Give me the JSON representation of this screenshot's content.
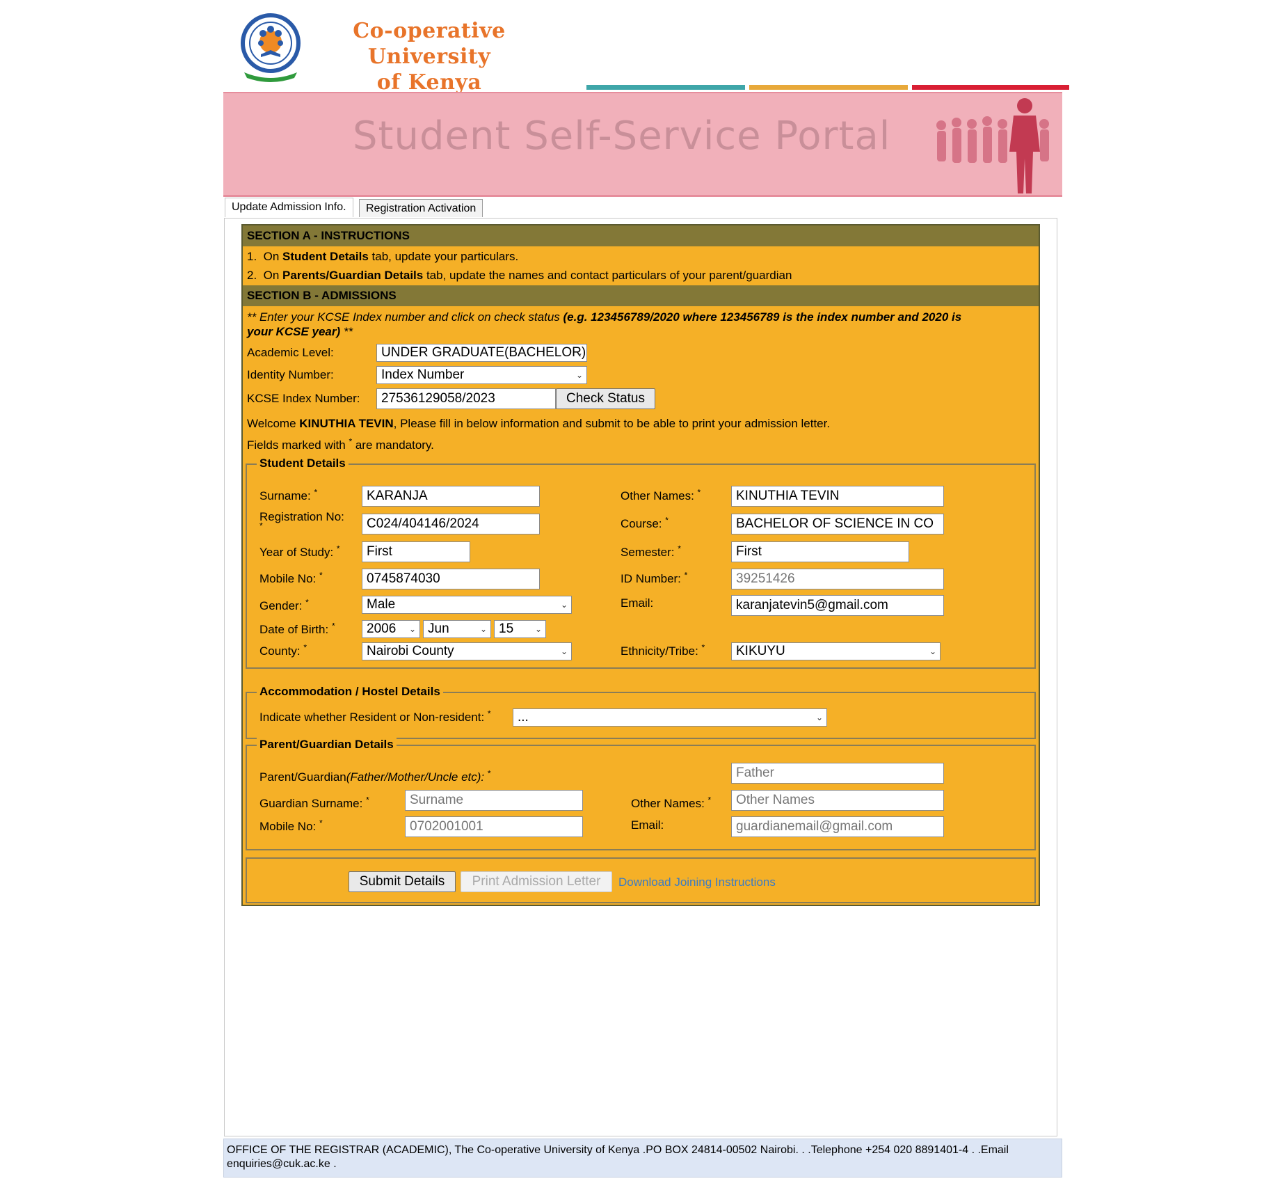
{
  "header": {
    "logo_line1": "Co-operative University",
    "logo_line2": "of Kenya",
    "banner_title": "Student Self-Service Portal",
    "stripe_colors": [
      "#3fa6a9",
      "#e8a93a",
      "#d91f34"
    ]
  },
  "tabs": [
    {
      "label": "Update Admission Info.",
      "active": true
    },
    {
      "label": "Registration Activation",
      "active": false
    }
  ],
  "section_a": {
    "title": "SECTION A - INSTRUCTIONS",
    "line1_num": "1.",
    "line1_pre": "On ",
    "line1_bold": "Student Details",
    "line1_post": " tab, update your particulars.",
    "line2_num": "2.",
    "line2_pre": "On ",
    "line2_bold": "Parents/Guardian Details",
    "line2_post": " tab, update the names and contact particulars of your parent/guardian"
  },
  "section_b": {
    "title": "SECTION B - ADMISSIONS",
    "note_a": "** Enter your KCSE Index number and click on check status ",
    "note_b": "(e.g. 123456789/2020 where 123456789 is the index number and 2020 is",
    "note_c": "your KCSE year)",
    "note_d": " **",
    "academic_level_label": "Academic Level:",
    "academic_level_value": "UNDER GRADUATE(BACHELOR)",
    "identity_label": "Identity Number:",
    "identity_value": "Index Number",
    "kcse_label": "KCSE Index Number:",
    "kcse_value": "27536129058/2023",
    "check_status_label": "Check Status",
    "welcome_pre": "Welcome ",
    "welcome_name": "KINUTHIA TEVIN",
    "welcome_post": ", Please fill in below information and submit to be able to print your admission letter.",
    "mandatory_pre": "Fields marked with ",
    "mandatory_post": " are mandatory."
  },
  "student_details": {
    "legend": "Student Details",
    "surname_label": "Surname:",
    "surname_value": "KARANJA",
    "other_names_label": "Other Names:",
    "other_names_value": "KINUTHIA TEVIN",
    "reg_label": "Registration No:",
    "reg_value": "C024/404146/2024",
    "course_label": "Course:",
    "course_value": "BACHELOR OF SCIENCE IN CO",
    "year_label": "Year of Study:",
    "year_value": "First",
    "semester_label": "Semester:",
    "semester_value": "First",
    "mobile_label": "Mobile No:",
    "mobile_value": "0745874030",
    "id_label": "ID Number:",
    "id_value": "39251426",
    "gender_label": "Gender:",
    "gender_value": "Male",
    "email_label": "Email:",
    "email_value": "karanjatevin5@gmail.com",
    "dob_label": "Date of Birth:",
    "dob_year": "2006",
    "dob_month": "Jun",
    "dob_day": "15",
    "county_label": "County:",
    "county_value": "Nairobi County",
    "ethnicity_label": "Ethnicity/Tribe:",
    "ethnicity_value": "KIKUYU"
  },
  "accommodation": {
    "legend": "Accommodation / Hostel Details",
    "label": "Indicate whether Resident or Non-resident:",
    "value": "..."
  },
  "guardian": {
    "legend": "Parent/Guardian Details",
    "relation_label_a": "Parent/Guardian",
    "relation_label_b": "(Father/Mother/Uncle etc):",
    "relation_placeholder": "Father",
    "surname_label": "Guardian Surname:",
    "surname_placeholder": "Surname",
    "other_names_label": "Other Names:",
    "other_names_placeholder": "Other Names",
    "mobile_label": "Mobile No:",
    "mobile_placeholder": "0702001001",
    "email_label": "Email:",
    "email_placeholder": "guardianemail@gmail.com"
  },
  "actions": {
    "submit_label": "Submit Details",
    "print_label": "Print Admission Letter",
    "download_label": "Download Joining Instructions"
  },
  "footer": {
    "text": "OFFICE OF THE REGISTRAR (ACADEMIC), The Co-operative University of Kenya .PO BOX 24814-00502 Nairobi. . .Telephone +254 020 8891401-4 . .Email enquiries@cuk.ac.ke ."
  },
  "colors": {
    "panel": "#f5b027",
    "section_header": "#837837",
    "banner": "#f1b0ba",
    "link": "#3b7cc4"
  }
}
